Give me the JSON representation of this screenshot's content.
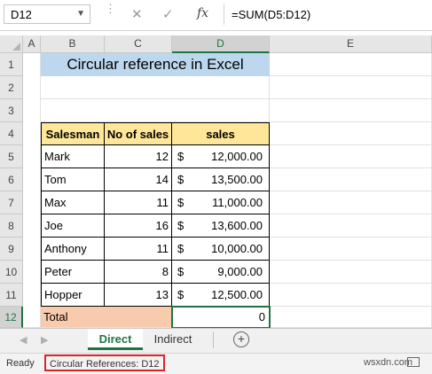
{
  "formula_bar": {
    "name_box": "D12",
    "fx_label": "fx",
    "formula": "=SUM(D5:D12)",
    "cancel_glyph": "✕",
    "enter_glyph": "✓"
  },
  "columns": [
    "A",
    "B",
    "C",
    "D",
    "E"
  ],
  "rows": [
    "1",
    "2",
    "3",
    "4",
    "5",
    "6",
    "7",
    "8",
    "9",
    "10",
    "11",
    "12"
  ],
  "sheet": {
    "title": "Circular reference in Excel",
    "headers": {
      "salesman": "Salesman",
      "no_of_sales": "No of sales",
      "sales": "sales"
    },
    "data": [
      {
        "name": "Mark",
        "count": "12",
        "currency": "$",
        "amount": "12,000.00"
      },
      {
        "name": "Tom",
        "count": "14",
        "currency": "$",
        "amount": "13,500.00"
      },
      {
        "name": "Max",
        "count": "11",
        "currency": "$",
        "amount": "11,000.00"
      },
      {
        "name": "Joe",
        "count": "16",
        "currency": "$",
        "amount": "13,600.00"
      },
      {
        "name": "Anthony",
        "count": "11",
        "currency": "$",
        "amount": "10,000.00"
      },
      {
        "name": "Peter",
        "count": "8",
        "currency": "$",
        "amount": "9,000.00"
      },
      {
        "name": "Hopper",
        "count": "13",
        "currency": "$",
        "amount": "12,500.00"
      }
    ],
    "total_label": "Total",
    "total_value": "0"
  },
  "tabs": {
    "active": "Direct",
    "inactive": "Indirect",
    "add": "+"
  },
  "status_bar": {
    "ready": "Ready",
    "circular": "Circular References: D12",
    "watermark": "wsxdn.com"
  },
  "colors": {
    "accent": "#217346",
    "title_fill": "#bdd7ee",
    "header_fill": "#ffe699",
    "total_fill": "#f8cbad",
    "highlight_box": "#d9232e"
  }
}
